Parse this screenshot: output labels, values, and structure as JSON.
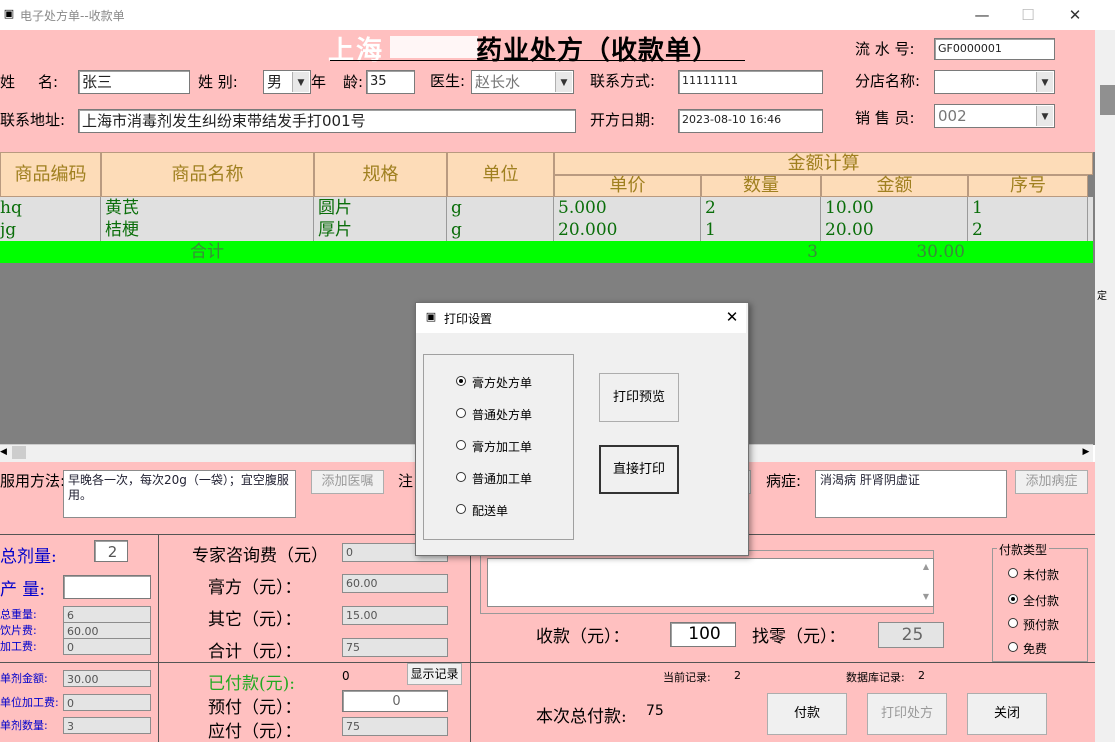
{
  "window": {
    "title": "电子处方单--收款单",
    "app_icon": "prescription-app-icon"
  },
  "header": {
    "title_obscured": "上海",
    "title": "药业处方（收款单）",
    "serial_label": "流 水 号:",
    "serial_value": "GF0000001",
    "name_label_1": "姓",
    "name_label_2": "名:",
    "name_value": "张三",
    "gender_label": "姓  别:",
    "gender_value": "男",
    "age_label_1": "年",
    "age_label_2": "龄:",
    "age_value": "35",
    "doctor_label": "医生:",
    "doctor_value": "赵长水",
    "contact_label": "联系方式:",
    "contact_value": "11111111",
    "branch_label": "分店名称:",
    "branch_value": "",
    "address_label": "联系地址:",
    "address_value": "上海市消毒剂发生纠纷束带结发手打001号",
    "date_label": "开方日期:",
    "date_value": "2023-08-10 16:46",
    "sales_label": "销 售 员:",
    "sales_value": "002"
  },
  "table": {
    "headers": {
      "code": "商品编码",
      "name": "商品名称",
      "spec": "规格",
      "unit": "单位",
      "amount_group": "金额计算",
      "price": "单价",
      "qty": "数量",
      "amount": "金额",
      "seq": "序号"
    },
    "rows": [
      {
        "code": "hq",
        "name": "黄芪",
        "spec": "圆片",
        "unit": "g",
        "price": "5.000",
        "qty": "2",
        "amount": "10.00",
        "seq": "1"
      },
      {
        "code": "jg",
        "name": "桔梗",
        "spec": "厚片",
        "unit": "g",
        "price": "20.000",
        "qty": "1",
        "amount": "20.00",
        "seq": "2"
      }
    ],
    "total": {
      "label": "合计",
      "qty": "3",
      "amount": "30.00"
    },
    "side_label": "定"
  },
  "usage": {
    "label": "服用方法:",
    "text": "早晚各一次，每次20g（一袋）；宜空腹服用。",
    "add_advice_button": "添加医嘱",
    "note_label": "注",
    "disease_label": "病症:",
    "disease_text": "消渴病  肝肾阴虚证",
    "add_disease_button": "添加病症"
  },
  "left_panel": {
    "total_doses_label": "总剂量:",
    "total_doses_value": "2",
    "yield_label": "产   量:",
    "yield_value": "",
    "total_weight_label": "总重量:",
    "total_weight_value": "6",
    "slice_fee_label": "饮片费:",
    "slice_fee_value": "60.00",
    "process_fee_label": "加工费:",
    "process_fee_value": "0",
    "dose_amount_label": "单剂金额:",
    "dose_amount_value": "30.00",
    "unit_process_label": "单位加工费:",
    "unit_process_value": "0",
    "dose_count_label": "单剂数量:",
    "dose_count_value": "3"
  },
  "fees": {
    "consult_label": "专家咨询费（元）",
    "consult_value": "0",
    "paste_label": "膏方（元）：",
    "paste_value": "60.00",
    "other_label": "其它（元）：",
    "other_value": "15.00",
    "sum_label": "合计（元）：",
    "sum_value": "75",
    "paid_label": "已付款(元):",
    "paid_value": "0",
    "prepay_label": "预付（元）：",
    "prepay_value": "0",
    "due_label": "应付（元）：",
    "due_value": "75",
    "show_records_button": "显示记录"
  },
  "payment": {
    "received_label": "收款（元）：",
    "received_value": "100",
    "change_label": "找零（元）：",
    "change_value": "25",
    "current_record_label": "当前记录:",
    "current_record_value": "2",
    "db_record_label": "数据库记录:",
    "db_record_value": "2",
    "total_paid_label": "本次总付款:",
    "total_paid_value": "75",
    "pay_button": "付款",
    "print_button": "打印处方",
    "close_button": "关闭",
    "type_group_label": "付款类型",
    "types": [
      "未付款",
      "全付款",
      "预付款",
      "免费"
    ],
    "selected_type": "全付款"
  },
  "dialog": {
    "title": "打印设置",
    "options": [
      "膏方处方单",
      "普通处方单",
      "膏方加工单",
      "普通加工单",
      "配送单"
    ],
    "selected": "膏方处方单",
    "preview_button": "打印预览",
    "direct_print_button": "直接打印"
  }
}
